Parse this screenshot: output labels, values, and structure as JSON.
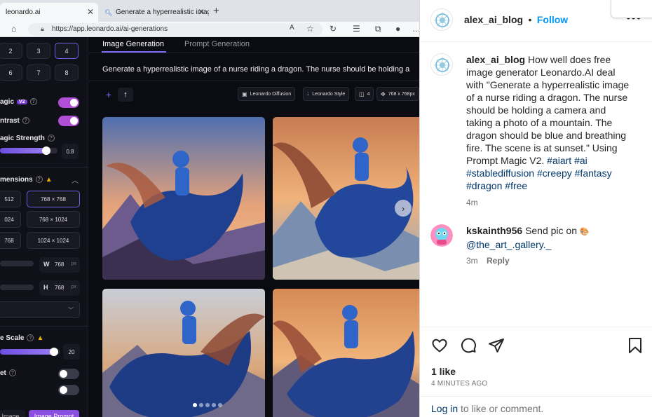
{
  "browser": {
    "tabs": [
      {
        "label": "leonardo.ai",
        "active": true
      },
      {
        "label": "Generate a hyperrealistic image",
        "active": false
      }
    ],
    "url": "https://app.leonardo.ai/ai-generations"
  },
  "leonardo": {
    "sidebar": {
      "num_buttons": [
        "2",
        "3",
        "4",
        "6",
        "7",
        "8"
      ],
      "selected_num": "4",
      "prompt_magic_label": "agic",
      "prompt_magic_version": "V2",
      "high_contrast_label": "ntrast",
      "magic_strength_label": "agic Strength",
      "magic_strength_value": "0.8",
      "magic_strength_fraction": 0.8,
      "dimensions_label": "mensions",
      "dimension_options": [
        {
          "left": "512",
          "right": "768 × 768",
          "selected": "right"
        },
        {
          "left": "024",
          "right": "768 × 1024"
        },
        {
          "left": "768",
          "right": "1024 × 1024"
        }
      ],
      "width_label": "W",
      "width_value": "768",
      "height_label": "H",
      "height_value": "768",
      "unit": "px",
      "guidance_scale_label": "e Scale",
      "guidance_scale_value": "20",
      "guidance_scale_fraction": 0.9,
      "tiling_label": "et",
      "bottom_left_label": "Image",
      "bottom_right_label": "Image Prompt"
    },
    "main": {
      "tab_image_generation": "Image Generation",
      "tab_prompt_generation": "Prompt Generation",
      "prompt_text": "Generate a hyperrealistic image of a nurse riding a dragon. The nurse should be holding a",
      "chips": [
        "Leonardo Diffusion",
        "Leonardo Style",
        "4",
        "768 x 768px"
      ]
    }
  },
  "instagram": {
    "username": "alex_ai_blog",
    "follow_label": "Follow",
    "separator": "•",
    "caption_text": "How well does free image generator Leonardo.AI deal with \"Generate a hyperrealistic image of a nurse riding a dragon. The nurse should be holding a camera and taking a photo of a mountain. The dragon should be blue and breathing fire. The scene is at sunset.\" Using Prompt Magic V2.",
    "hashtags": [
      "#aiart",
      "#ai",
      "#stablediffusion",
      "#creepy",
      "#fantasy",
      "#dragon",
      "#free"
    ],
    "caption_time": "4m",
    "comment": {
      "username": "kskainth956",
      "text": "Send pic on",
      "emoji": "🎨",
      "mention": "@the_art_.gallery._",
      "time": "3m",
      "reply_label": "Reply"
    },
    "likes": "1 like",
    "posted_ago": "4 MINUTES AGO",
    "login_link": "Log in",
    "login_rest": " to like or comment."
  }
}
